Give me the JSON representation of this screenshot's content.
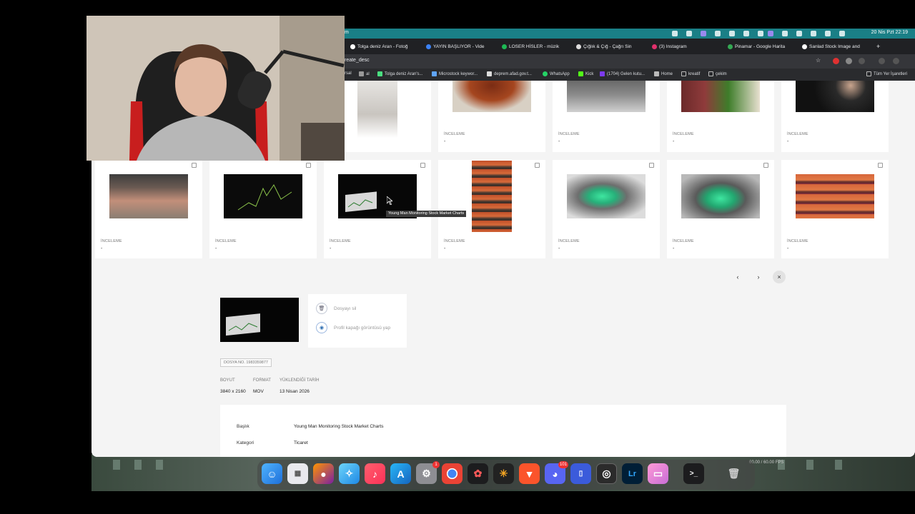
{
  "menubar": {
    "datetime": "20 Nis Pzt  22:19",
    "left_fragment": "m"
  },
  "tabs": [
    {
      "label": "Tolga deniz Aran - Fotoğ",
      "color": "#ffffff"
    },
    {
      "label": "YAYIN BAŞLIYOR - Vide",
      "color": "#3b82f6"
    },
    {
      "label": "LOSER HİSLER - müzik",
      "color": "#1db954"
    },
    {
      "label": "Çığlık & Çığ - Çağrı Sin",
      "color": "#f0f0f0"
    },
    {
      "label": "(3) Instagram",
      "color": "#e1306c"
    },
    {
      "label": "Pinamar - Google Harita",
      "color": "#34a853"
    },
    {
      "label": "Sanlad Stock Image and",
      "color": "#ffffff"
    }
  ],
  "address_bar": {
    "url": "reate_desc"
  },
  "bookmarks": [
    "rsal",
    "al",
    "Tolga deniz Aran's...",
    "Microstock keywor...",
    "deprem.afad.gov.t...",
    "WhatsApp",
    "Kick",
    "(1704) Gelen kutu...",
    "Home",
    "kreatif",
    "çekim"
  ],
  "bookmarks_right": "Tüm Yer İşaretleri",
  "grid": {
    "row1": [
      {
        "label": "İNCELEME",
        "value": "-"
      },
      {
        "label": "İNCELEME",
        "value": "-"
      },
      {
        "label": "İNCELEME",
        "value": "-"
      },
      {
        "label": "İNCELEME",
        "value": "-"
      },
      {
        "label": "İNCELEME",
        "value": "-"
      }
    ],
    "row2": [
      {
        "label": "İNCELEME",
        "value": "-"
      },
      {
        "label": "İNCELEME",
        "value": "-"
      },
      {
        "label": "İNCELEME",
        "value": "-"
      },
      {
        "label": "İNCELEME",
        "value": "-"
      },
      {
        "label": "İNCELEME",
        "value": "-"
      },
      {
        "label": "İNCELEME",
        "value": "-"
      },
      {
        "label": "İNCELEME",
        "value": "-"
      }
    ]
  },
  "tooltip": "Young Man Monitoring Stock Market Charts",
  "pager": {
    "prev": "‹",
    "next": "›",
    "close": "×"
  },
  "actions": {
    "delete": "Dosyayı sil",
    "cover": "Profil kapağı görüntüsü yap"
  },
  "file_no": "DOSYA NO. 1983359877",
  "meta": {
    "size_label": "BOYUT",
    "size_value": "3840 x 2160",
    "format_label": "FORMAT",
    "format_value": "MOV",
    "uploaded_label": "YÜKLENDİĞİ TARİH",
    "uploaded_value": "13 Nisan 2026"
  },
  "info": {
    "title_key": "Başlık",
    "title_value": "Young Man Monitoring Stock Market Charts",
    "category_key": "Kategori",
    "category_value": "Ticaret"
  },
  "overlay": {
    "fps": "60.00 / 60.00 FPS"
  },
  "dock": {
    "badge_settings": "1",
    "badge_discord": "101",
    "lightroom_label": "Lr"
  }
}
